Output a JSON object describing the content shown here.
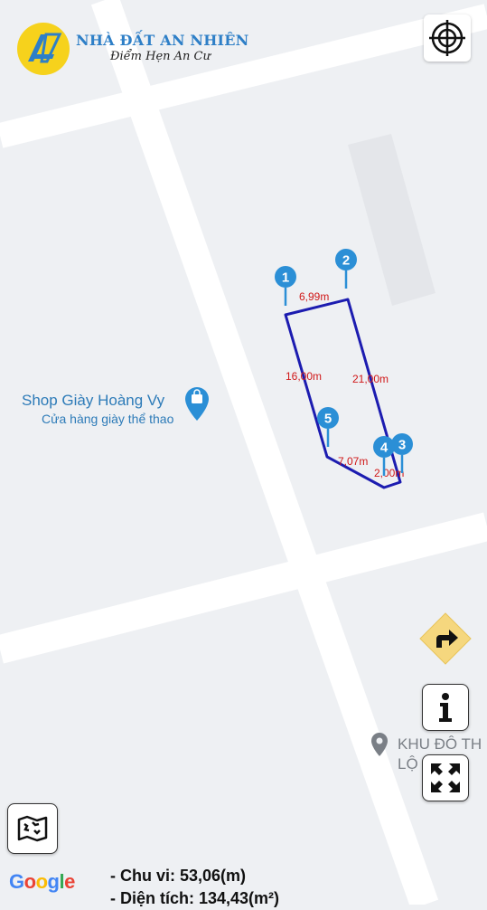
{
  "brand": {
    "name": "NHÀ ĐẤT AN NHIÊN",
    "slogan": "Điểm Hẹn An Cư"
  },
  "places": {
    "shop_name": "Shop Giày Hoàng Vy",
    "shop_category": "Cửa hàng giày thể thao",
    "area_label_line1": "KHU ĐÔ TH",
    "area_label_line2": "LỘ      LÝ"
  },
  "parcel": {
    "markers": [
      "1",
      "2",
      "3",
      "4",
      "5"
    ],
    "edges": [
      "6,99m",
      "21,00m",
      "2,00m",
      "7,07m",
      "16,00m"
    ]
  },
  "summary": {
    "perimeter": "- Chu vi: 53,06(m)",
    "area": "- Diện tích: 134,43(m²)"
  },
  "google": [
    "G",
    "o",
    "o",
    "g",
    "l",
    "e"
  ],
  "colors": {
    "road": "#ffffff",
    "block": "#eef0f3",
    "parcel": "#1c1cb0",
    "edge_label": "#d01818",
    "marker": "#2b8fd6",
    "brand": "#2e7fc7",
    "direction": "#f5d77e",
    "google": [
      "#4285F4",
      "#EA4335",
      "#FBBC05",
      "#4285F4",
      "#34A853",
      "#EA4335"
    ]
  },
  "icons": [
    "logo",
    "crosshair-icon",
    "direction-icon",
    "info-icon",
    "expand-icon",
    "map-type-icon",
    "shopping-bag-icon",
    "location-pin-icon"
  ]
}
